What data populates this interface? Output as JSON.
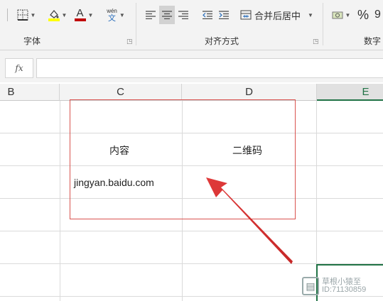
{
  "ribbon": {
    "groups": [
      {
        "label": "字体"
      },
      {
        "label": "对齐方式"
      },
      {
        "label": "数字"
      }
    ],
    "font_color_glyph": "A",
    "phonetic_glyph_top": "wén",
    "phonetic_glyph_bottom": "文",
    "merge_label": "合并后居中",
    "percent_glyph": "%",
    "comma_glyph": "9"
  },
  "formula_bar": {
    "fx_label": "fx",
    "value": ""
  },
  "columns": [
    {
      "label": "B"
    },
    {
      "label": "C"
    },
    {
      "label": "D"
    },
    {
      "label": "E"
    }
  ],
  "cells": {
    "c_header": "内容",
    "d_header": "二维码",
    "c_url": "jingyan.baidu.com"
  },
  "watermark": {
    "line1": "草根小猿至",
    "line2": "ID:71130859"
  },
  "colors": {
    "selection_green": "#217346",
    "annotation_red": "#d9534f",
    "font_color_red": "#c00000",
    "fill_yellow": "#ffff00"
  }
}
